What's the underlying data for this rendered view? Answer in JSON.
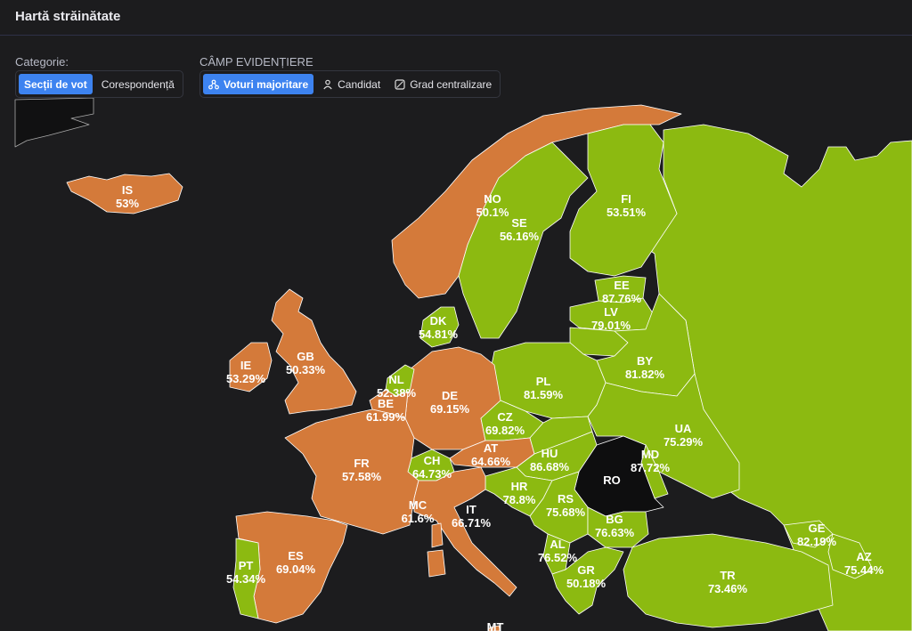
{
  "header": {
    "title": "Hartă străinătate"
  },
  "category": {
    "label": "Categorie:",
    "options": [
      {
        "label": "Secții de vot",
        "active": true
      },
      {
        "label": "Corespondență",
        "active": false
      }
    ]
  },
  "highlight_field": {
    "label": "CÂMP EVIDENȚIERE",
    "options": [
      {
        "label": "Voturi majoritare",
        "icon": "network-icon",
        "active": true
      },
      {
        "label": "Candidat",
        "icon": "person-icon",
        "active": false
      },
      {
        "label": "Grad centralizare",
        "icon": "gauge-icon",
        "active": false
      }
    ]
  },
  "colors": {
    "orange": "#d47a3a",
    "green": "#8cba11",
    "romania": "#0e0e0f",
    "sea": "#1c1c1e",
    "border": "#ffffff"
  },
  "countries": [
    {
      "code": "IS",
      "value": "53%",
      "color": "orange"
    },
    {
      "code": "NO",
      "value": "50.1%",
      "color": "orange"
    },
    {
      "code": "SE",
      "value": "56.16%",
      "color": "green"
    },
    {
      "code": "FI",
      "value": "53.51%",
      "color": "green"
    },
    {
      "code": "EE",
      "value": "87.76%",
      "color": "green"
    },
    {
      "code": "LV",
      "value": "79.01%",
      "color": "green"
    },
    {
      "code": "DK",
      "value": "54.81%",
      "color": "green"
    },
    {
      "code": "GB",
      "value": "50.33%",
      "color": "orange"
    },
    {
      "code": "IE",
      "value": "53.29%",
      "color": "orange"
    },
    {
      "code": "NL",
      "value": "52.38%",
      "color": "green"
    },
    {
      "code": "BE",
      "value": "61.99%",
      "color": "orange"
    },
    {
      "code": "DE",
      "value": "69.15%",
      "color": "orange"
    },
    {
      "code": "PL",
      "value": "81.59%",
      "color": "green"
    },
    {
      "code": "BY",
      "value": "81.82%",
      "color": "green"
    },
    {
      "code": "CZ",
      "value": "69.82%",
      "color": "green"
    },
    {
      "code": "UA",
      "value": "75.29%",
      "color": "green"
    },
    {
      "code": "FR",
      "value": "57.58%",
      "color": "orange"
    },
    {
      "code": "AT",
      "value": "64.66%",
      "color": "orange"
    },
    {
      "code": "HU",
      "value": "86.68%",
      "color": "green"
    },
    {
      "code": "MD",
      "value": "87.72%",
      "color": "green"
    },
    {
      "code": "CH",
      "value": "64.73%",
      "color": "green"
    },
    {
      "code": "RO",
      "value": "",
      "color": "romania"
    },
    {
      "code": "HR",
      "value": "78.8%",
      "color": "green"
    },
    {
      "code": "RS",
      "value": "75.68%",
      "color": "green"
    },
    {
      "code": "MC",
      "value": "61.6%",
      "color": "orange"
    },
    {
      "code": "IT",
      "value": "66.71%",
      "color": "orange"
    },
    {
      "code": "BG",
      "value": "76.63%",
      "color": "green"
    },
    {
      "code": "GE",
      "value": "82.19%",
      "color": "green"
    },
    {
      "code": "ES",
      "value": "69.04%",
      "color": "orange"
    },
    {
      "code": "AL",
      "value": "76.52%",
      "color": "green"
    },
    {
      "code": "AZ",
      "value": "75.44%",
      "color": "green"
    },
    {
      "code": "PT",
      "value": "54.34%",
      "color": "green"
    },
    {
      "code": "GR",
      "value": "50.18%",
      "color": "green"
    },
    {
      "code": "TR",
      "value": "73.46%",
      "color": "green"
    },
    {
      "code": "MT",
      "value": "",
      "color": "orange"
    }
  ]
}
